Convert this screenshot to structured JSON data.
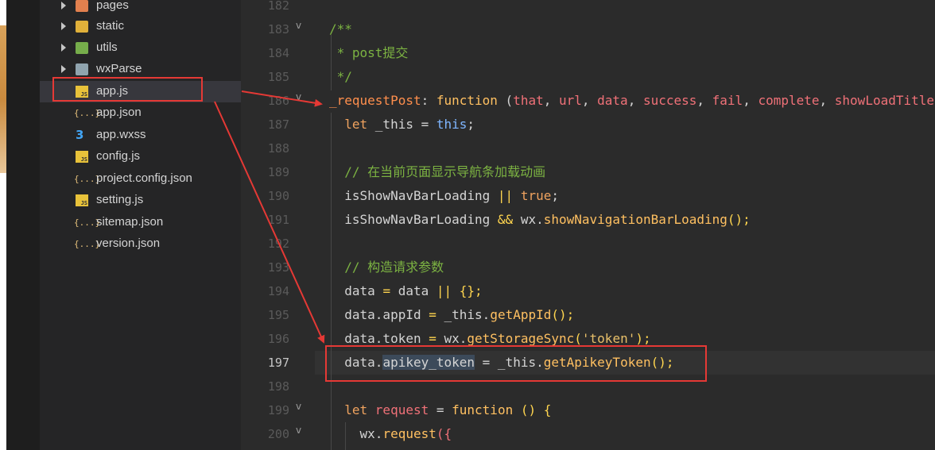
{
  "colors": {
    "annotation_red": "#e53935",
    "editor_bg": "#2b2b2b",
    "sidebar_bg": "#252526"
  },
  "explorer": {
    "items": [
      {
        "label": "pages",
        "icon": "folder-pages-icon",
        "type": "folder"
      },
      {
        "label": "static",
        "icon": "folder-static-icon",
        "type": "folder"
      },
      {
        "label": "utils",
        "icon": "folder-utils-icon",
        "type": "folder"
      },
      {
        "label": "wxParse",
        "icon": "folder-icon",
        "type": "folder"
      },
      {
        "label": "app.js",
        "icon": "js-file-icon",
        "type": "file",
        "selected": true,
        "js_badge": "JS"
      },
      {
        "label": "app.json",
        "icon": "json-file-icon",
        "type": "file",
        "glyph": "{...}"
      },
      {
        "label": "app.wxss",
        "icon": "css-file-icon",
        "type": "file",
        "glyph": "3"
      },
      {
        "label": "config.js",
        "icon": "js-file-icon",
        "type": "file",
        "js_badge": "JS"
      },
      {
        "label": "project.config.json",
        "icon": "json-file-icon",
        "type": "file",
        "glyph": "{...}"
      },
      {
        "label": "setting.js",
        "icon": "js-file-icon",
        "type": "file",
        "js_badge": "JS"
      },
      {
        "label": "sitemap.json",
        "icon": "json-file-icon",
        "type": "file",
        "glyph": "{...}"
      },
      {
        "label": "version.json",
        "icon": "json-file-icon",
        "type": "file",
        "glyph": "{...}"
      }
    ]
  },
  "editor": {
    "active_line": "197",
    "lines": [
      {
        "num": "182",
        "fold": ""
      },
      {
        "num": "183",
        "fold": "v",
        "t1": "/**"
      },
      {
        "num": "184",
        "fold": "",
        "t1": " * post提交"
      },
      {
        "num": "185",
        "fold": "",
        "t1": " */"
      },
      {
        "num": "186",
        "fold": "v",
        "t1": "_requestPost",
        "t2": ": ",
        "t3": "function",
        "t4": " (",
        "t5": "that",
        "t6": ", ",
        "t7": "url",
        "t8": ", ",
        "t9": "data",
        "t10": ", ",
        "t11": "success",
        "t12": ", ",
        "t13": "fail",
        "t14": ", ",
        "t15": "complete",
        "t16": ", ",
        "t17": "showLoadTitle"
      },
      {
        "num": "187",
        "fold": "",
        "t1": "  let ",
        "t2": "_this",
        "t3": " = ",
        "t4": "this",
        "t5": ";"
      },
      {
        "num": "188",
        "fold": ""
      },
      {
        "num": "189",
        "fold": "",
        "t1": "  // 在当前页面显示导航条加载动画"
      },
      {
        "num": "190",
        "fold": "",
        "t1": "  isShowNavBarLoading ",
        "t2": "||",
        "t3": " ",
        "t4": "true",
        "t5": ";"
      },
      {
        "num": "191",
        "fold": "",
        "t1": "  isShowNavBarLoading ",
        "t2": "&&",
        "t3": " wx.",
        "t4": "showNavigationBarLoading",
        "t5": "();"
      },
      {
        "num": "192",
        "fold": ""
      },
      {
        "num": "193",
        "fold": "",
        "t1": "  // 构造请求参数"
      },
      {
        "num": "194",
        "fold": "",
        "t1": "  data ",
        "t2": "=",
        "t3": " data ",
        "t4": "||",
        "t5": " {};"
      },
      {
        "num": "195",
        "fold": "",
        "t1": "  data.appId ",
        "t2": "=",
        "t3": " _this.",
        "t4": "getAppId",
        "t5": "();"
      },
      {
        "num": "196",
        "fold": "",
        "t1": "  data.token ",
        "t2": "=",
        "t3": " wx.",
        "t4": "getStorageSync",
        "t5": "(",
        "t6": "'token'",
        "t7": ");"
      },
      {
        "num": "197",
        "fold": "",
        "t1": "  data.",
        "t2": "apikey_token",
        "t3": " = _this.",
        "t4": "getApikeyToken",
        "t5": "();"
      },
      {
        "num": "198",
        "fold": ""
      },
      {
        "num": "199",
        "fold": "v",
        "t1": "  let ",
        "t2": "request",
        "t3": " = ",
        "t4": "function",
        "t5": " () {"
      },
      {
        "num": "200",
        "fold": "v",
        "t1": "    wx.",
        "t2": "request",
        "t3": "({"
      }
    ]
  }
}
